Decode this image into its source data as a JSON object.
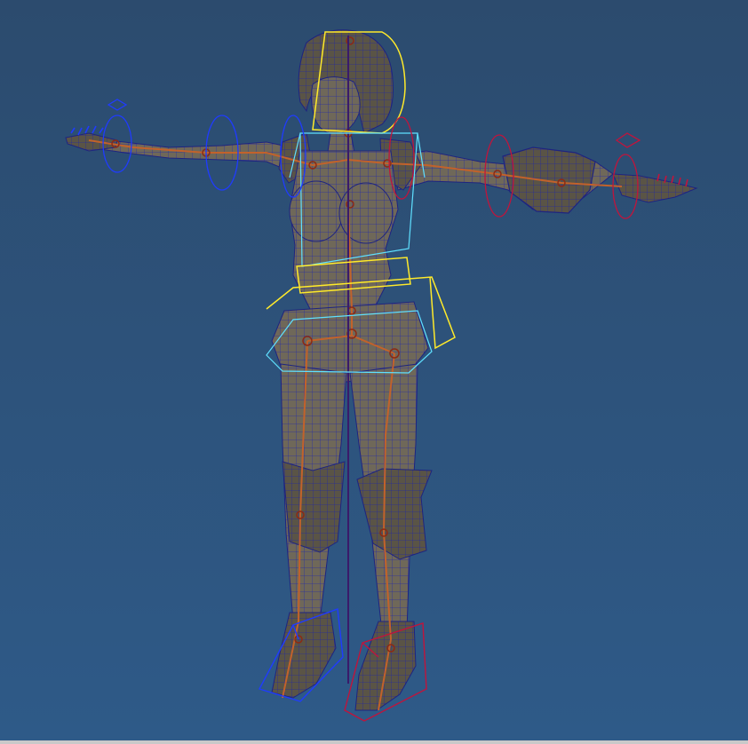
{
  "viewport": {
    "background_top": "#2c4b6e",
    "background_bottom": "#2e5a88",
    "frame_color": "#c9c9c9"
  },
  "scene": {
    "mesh_fill": "#6f6859",
    "mesh_shadow": "#4f4a40",
    "wire_color": "#2a2fa0",
    "joint_color": "#c2622b",
    "controls": {
      "left_side": "#1f3bff",
      "right_side": "#c0143c",
      "torso": "#5fe0ff",
      "hip": "#ffea2a",
      "root": "#3a1a6a"
    }
  }
}
